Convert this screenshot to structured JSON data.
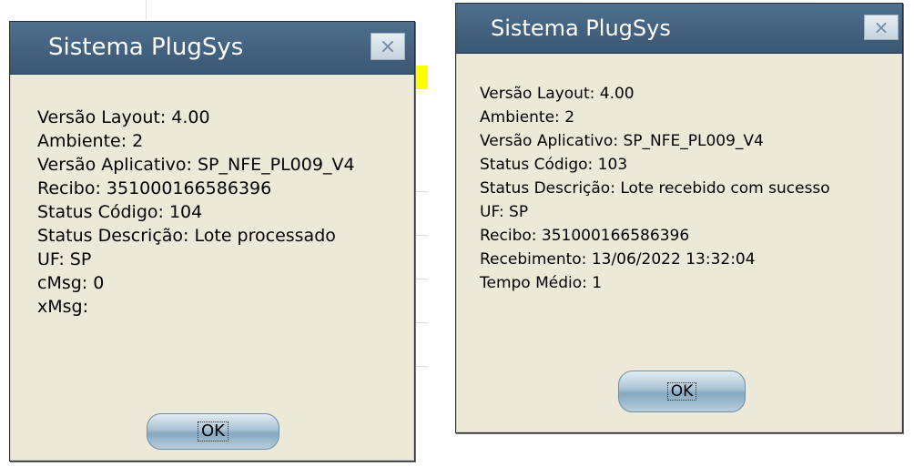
{
  "dialog1": {
    "title": "Sistema PlugSys",
    "close_icon": "×",
    "lines": [
      "Versão Layout: 4.00",
      "Ambiente: 2",
      "Versão Aplicativo: SP_NFE_PL009_V4",
      "Recibo: 351000166586396",
      "Status Código: 104",
      "Status Descrição: Lote processado",
      "UF: SP",
      "cMsg: 0",
      "xMsg:"
    ],
    "ok_label": "OK"
  },
  "dialog2": {
    "title": "Sistema PlugSys",
    "close_icon": "×",
    "lines": [
      "Versão Layout: 4.00",
      "Ambiente: 2",
      "Versão Aplicativo: SP_NFE_PL009_V4",
      "Status Código: 103",
      "Status Descrição: Lote recebido com sucesso",
      "UF: SP",
      "Recibo: 351000166586396",
      "Recebimento: 13/06/2022 13:32:04",
      "Tempo Médio: 1"
    ],
    "ok_label": "OK"
  },
  "colors": {
    "titlebar": "#3f5d79",
    "dialog_bg": "#ece9d8",
    "button": "#9bb8cc"
  }
}
